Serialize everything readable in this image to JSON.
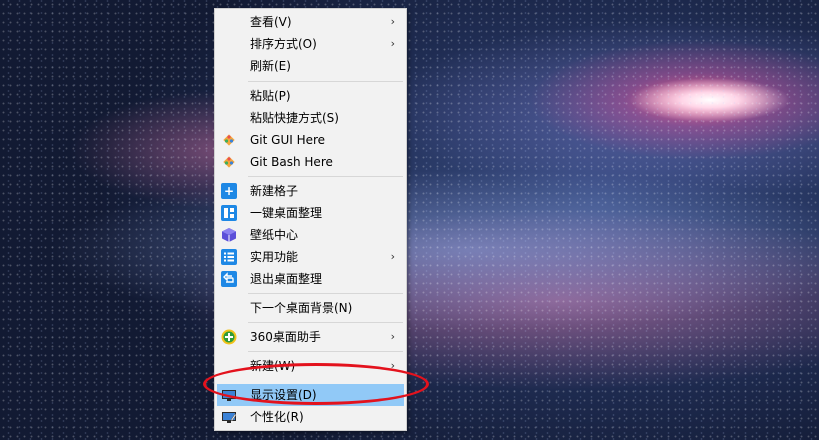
{
  "menu": {
    "items": [
      {
        "label": "查看(V)",
        "arrow": "›"
      },
      {
        "label": "排序方式(O)",
        "arrow": "›"
      },
      {
        "label": "刷新(E)"
      },
      {
        "label": "粘贴(P)"
      },
      {
        "label": "粘贴快捷方式(S)"
      },
      {
        "label": "Git GUI Here",
        "icon": "git-icon"
      },
      {
        "label": "Git Bash Here",
        "icon": "git-icon"
      },
      {
        "label": "新建格子",
        "icon": "plus-box-icon"
      },
      {
        "label": "一键桌面整理",
        "icon": "layout-grid-icon"
      },
      {
        "label": "壁纸中心",
        "icon": "cube-icon"
      },
      {
        "label": "实用功能",
        "icon": "list-icon",
        "arrow": "›"
      },
      {
        "label": "退出桌面整理",
        "icon": "exit-arrow-icon"
      },
      {
        "label": "下一个桌面背景(N)"
      },
      {
        "label": "360桌面助手",
        "icon": "360-icon",
        "arrow": "›"
      },
      {
        "label": "新建(W)",
        "arrow": "›"
      },
      {
        "label": "显示设置(D)",
        "icon": "display-icon"
      },
      {
        "label": "个性化(R)",
        "icon": "personalize-icon"
      }
    ]
  },
  "colors": {
    "highlight": "#91c9f7",
    "annotation": "#e3121d",
    "icon_blue": "#1e88e5"
  }
}
